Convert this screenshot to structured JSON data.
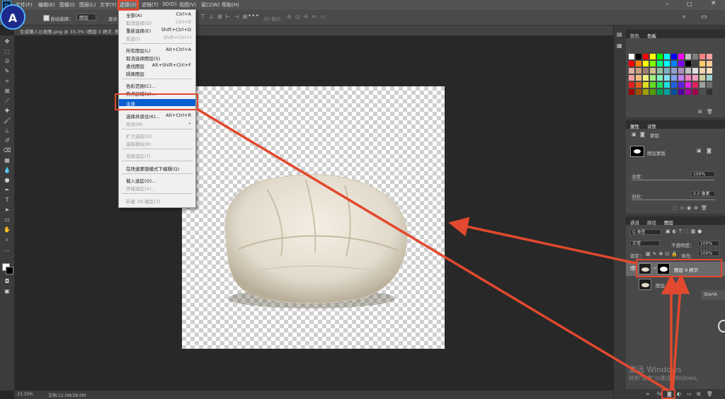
{
  "menubar": {
    "items": [
      "文件(F)",
      "编辑(E)",
      "图像(I)",
      "图层(L)",
      "文字(Y)",
      "选择(S)",
      "滤镜(T)",
      "3D(D)",
      "视图(V)",
      "窗口(W)",
      "帮助(H)"
    ],
    "selected_index": 5
  },
  "options": {
    "auto_select_label": "自动选择：",
    "auto_select_value": "图层",
    "show_transform_label": "显示",
    "mode_3d_label": "3D 模式："
  },
  "document": {
    "tab_title": "生成懒人沙发图.png @ 33.3% (图层 0 拷贝, 图..."
  },
  "status": {
    "zoom": "33.33%",
    "doc_size": "文档:12.0M/28.0M"
  },
  "select_menu": {
    "items": [
      {
        "label": "全部(A)",
        "shortcut": "Ctrl+A",
        "disabled": false
      },
      {
        "label": "取消选择(D)",
        "shortcut": "Ctrl+D",
        "disabled": true
      },
      {
        "label": "重新选择(E)",
        "shortcut": "Shift+Ctrl+D",
        "disabled": false
      },
      {
        "label": "反选(I)",
        "shortcut": "Shift+Ctrl+I",
        "disabled": true
      },
      {
        "label": "所有图层(L)",
        "shortcut": "Alt+Ctrl+A",
        "disabled": false
      },
      {
        "label": "取消选择图层(S)",
        "shortcut": "",
        "disabled": false
      },
      {
        "label": "查找图层",
        "shortcut": "Alt+Shift+Ctrl+F",
        "disabled": false
      },
      {
        "label": "隔离图层",
        "shortcut": "",
        "disabled": false
      },
      {
        "label": "色彩范围(C)...",
        "shortcut": "",
        "disabled": false
      },
      {
        "label": "焦点区域(U)...",
        "shortcut": "",
        "disabled": false
      },
      {
        "label": "主体",
        "shortcut": "",
        "disabled": false,
        "highlighted": true
      },
      {
        "label": "选择并遮住(K)...",
        "shortcut": "Alt+Ctrl+R",
        "disabled": false
      },
      {
        "label": "修改(M)",
        "shortcut": "▸",
        "disabled": true
      },
      {
        "label": "扩大选取(G)",
        "shortcut": "",
        "disabled": true
      },
      {
        "label": "选取相似(R)",
        "shortcut": "",
        "disabled": true
      },
      {
        "label": "变换选区(T)",
        "shortcut": "",
        "disabled": true
      },
      {
        "label": "在快速蒙版模式下编辑(Q)",
        "shortcut": "",
        "disabled": false
      },
      {
        "label": "载入选区(O)...",
        "shortcut": "",
        "disabled": false
      },
      {
        "label": "存储选区(V)...",
        "shortcut": "",
        "disabled": true
      },
      {
        "label": "新建 3D 模型(3)",
        "shortcut": "",
        "disabled": true
      }
    ]
  },
  "panels": {
    "swatches_tabs": [
      "颜色",
      "色板"
    ],
    "props_tabs": [
      "属性",
      "调整"
    ],
    "props_title": "蒙版",
    "props_mask_label": "图层蒙版",
    "density_label": "浓度：",
    "density_value": "100%",
    "feather_label": "羽化：",
    "feather_value": "0.0 像素",
    "layers_tabs": [
      "通道",
      "路径",
      "图层"
    ],
    "kind_label": "Q 类型",
    "blend_mode": "正常",
    "opacity_label": "不透明度：",
    "opacity_value": "100%",
    "lock_label": "锁定：",
    "fill_label": "填充：",
    "fill_value": "100%",
    "layers": [
      {
        "name": "图层 0 拷贝",
        "has_mask": true,
        "selected": true
      },
      {
        "name": "图层 0",
        "has_mask": false,
        "selected": false
      }
    ],
    "start_label": "StartA"
  },
  "watermark": {
    "title": "激活 Windows",
    "subtitle": "转到\"设置\"以激活 Windows。"
  },
  "swatch_colors": [
    "#ffffff",
    "#000000",
    "#ff0000",
    "#ffff00",
    "#00ff00",
    "#00ffff",
    "#0000ff",
    "#ff00ff",
    "#c0c0c0",
    "#808080",
    "#ff8080",
    "#ffa0a0",
    "#ff0000",
    "#ff8000",
    "#ffff00",
    "#80ff00",
    "#00ff80",
    "#00ffff",
    "#0080ff",
    "#8000ff",
    "#000000",
    "#404040",
    "#ffcc66",
    "#ffcc99",
    "#e0b0a0",
    "#c8a080",
    "#a08070",
    "#d0c090",
    "#90c0a0",
    "#80b0c0",
    "#90a0d0",
    "#b090c0",
    "#c0c0c0",
    "#e0e0e0",
    "#f0d0b0",
    "#f8e0c0",
    "#f0a0a0",
    "#f0c080",
    "#f0f080",
    "#a0f080",
    "#80f0c0",
    "#80e0f0",
    "#80a0f0",
    "#c080f0",
    "#f080c0",
    "#f0a0c0",
    "#d0d0a0",
    "#a0d0d0",
    "#e02020",
    "#e06020",
    "#e0e020",
    "#60e020",
    "#20e060",
    "#20e0e0",
    "#2060e0",
    "#6020e0",
    "#e020e0",
    "#e02060",
    "#a0a0a0",
    "#707070",
    "#a00000",
    "#a05000",
    "#a0a000",
    "#50a000",
    "#00a050",
    "#00a0a0",
    "#0050a0",
    "#5000a0",
    "#a000a0",
    "#a00050",
    "#505050",
    "#303030"
  ]
}
